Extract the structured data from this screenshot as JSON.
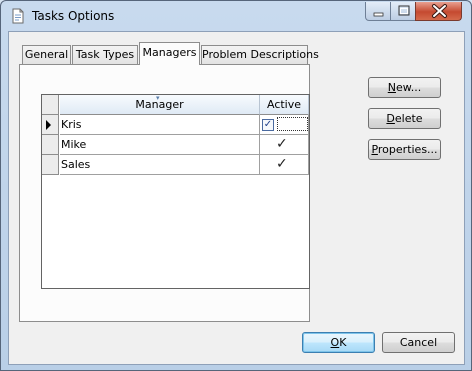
{
  "window": {
    "title": "Tasks Options",
    "icons": {
      "app": "document-icon",
      "minimize": "minimize-icon",
      "maximize": "maximize-icon",
      "close": "close-icon"
    }
  },
  "tabs": [
    {
      "label": "General",
      "active": false
    },
    {
      "label": "Task Types",
      "active": false
    },
    {
      "label": "Managers",
      "active": true
    },
    {
      "label": "Problem Descriptions",
      "active": false
    }
  ],
  "grid": {
    "columns": [
      "Manager",
      "Active"
    ],
    "rows": [
      {
        "manager": "Kris",
        "active": true,
        "current": true
      },
      {
        "manager": "Mike",
        "active": true,
        "current": false
      },
      {
        "manager": "Sales",
        "active": true,
        "current": false
      }
    ]
  },
  "side_buttons": {
    "new": {
      "mnemonic": "N",
      "rest": "ew..."
    },
    "delete": {
      "mnemonic": "D",
      "rest": "elete"
    },
    "properties": {
      "mnemonic": "P",
      "rest": "roperties..."
    }
  },
  "footer_buttons": {
    "ok": {
      "mnemonic": "O",
      "rest": "K"
    },
    "cancel": {
      "label": "Cancel"
    }
  },
  "colors": {
    "accent": "#3c7fb1",
    "close_button": "#c54a30",
    "header": "#dfeaf5"
  }
}
